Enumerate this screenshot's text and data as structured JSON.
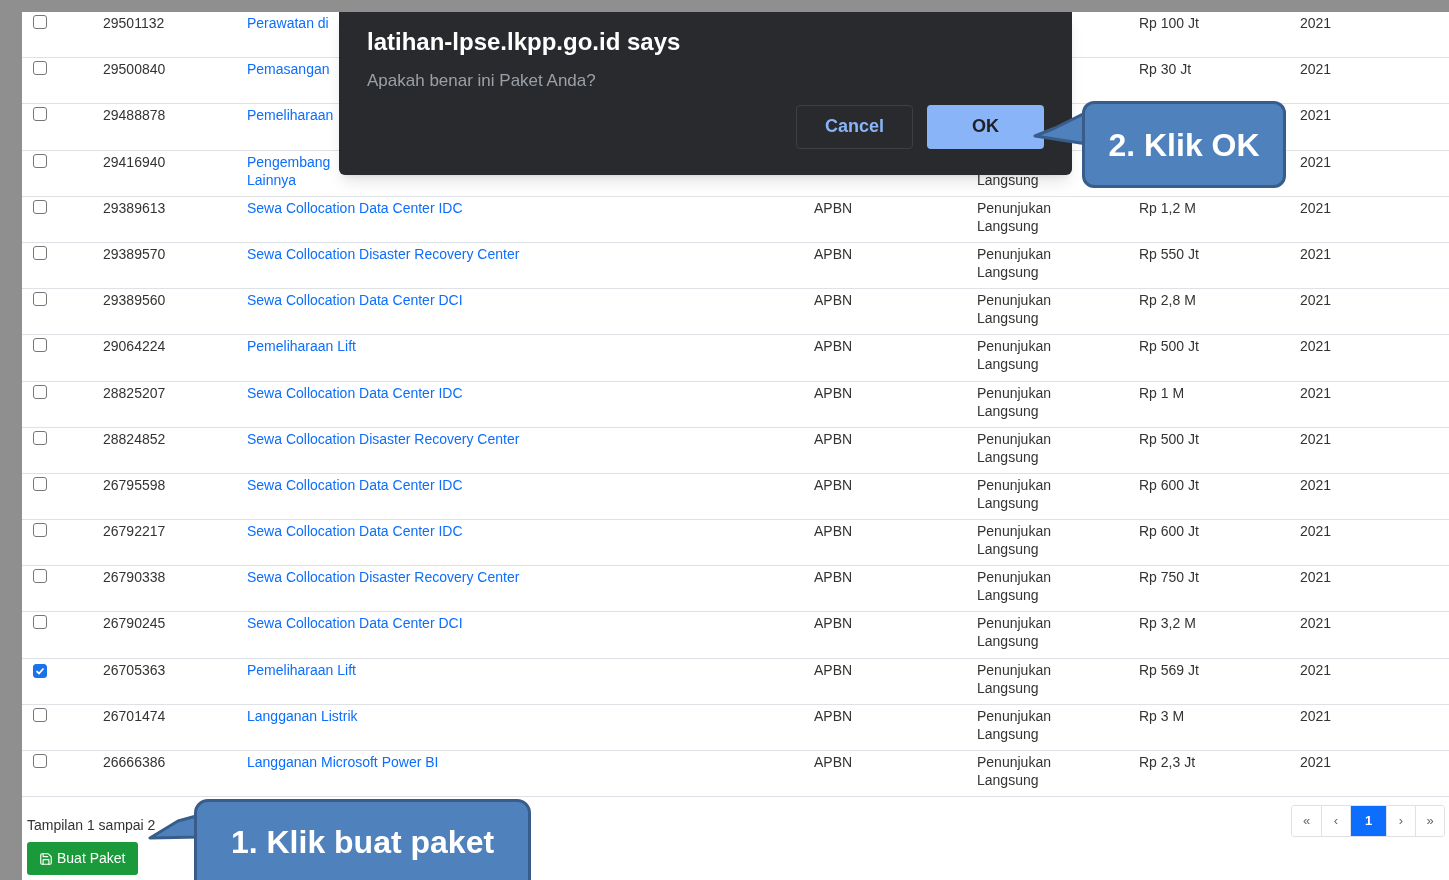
{
  "dialog": {
    "title": "latihan-lpse.lkpp.go.id says",
    "message": "Apakah benar ini Paket Anda?",
    "buttons": [
      {
        "label": "Cancel",
        "kind": "secondary"
      },
      {
        "label": "OK",
        "kind": "primary"
      }
    ]
  },
  "table": {
    "rows": [
      {
        "checked": false,
        "id": "29501132",
        "name": "Perawatan di",
        "pagu": "Rp 100 Jt",
        "year": "2021"
      },
      {
        "checked": false,
        "id": "29500840",
        "name": "Pemasangan",
        "pagu": "Rp 30 Jt",
        "year": "2021"
      },
      {
        "checked": false,
        "id": "29488878",
        "name": "Pemeliharaan",
        "year": "2021"
      },
      {
        "checked": false,
        "id": "29416940",
        "name": "Pengembang\nLainnya",
        "method": "\nLangsung",
        "year": "2021"
      },
      {
        "checked": false,
        "id": "29389613",
        "name": "Sewa Collocation Data Center IDC",
        "source": "APBN",
        "method": "Penunjukan\nLangsung",
        "pagu": "Rp 1,2 M",
        "year": "2021"
      },
      {
        "checked": false,
        "id": "29389570",
        "name": "Sewa Collocation Disaster Recovery Center",
        "source": "APBN",
        "method": "Penunjukan\nLangsung",
        "pagu": "Rp 550 Jt",
        "year": "2021"
      },
      {
        "checked": false,
        "id": "29389560",
        "name": "Sewa Collocation Data Center DCI",
        "source": "APBN",
        "method": "Penunjukan\nLangsung",
        "pagu": "Rp 2,8 M",
        "year": "2021"
      },
      {
        "checked": false,
        "id": "29064224",
        "name": "Pemeliharaan Lift",
        "source": "APBN",
        "method": "Penunjukan\nLangsung",
        "pagu": "Rp 500 Jt",
        "year": "2021"
      },
      {
        "checked": false,
        "id": "28825207",
        "name": "Sewa Collocation Data Center IDC",
        "source": "APBN",
        "method": "Penunjukan\nLangsung",
        "pagu": "Rp 1 M",
        "year": "2021"
      },
      {
        "checked": false,
        "id": "28824852",
        "name": "Sewa Collocation Disaster Recovery Center",
        "source": "APBN",
        "method": "Penunjukan\nLangsung",
        "pagu": "Rp 500 Jt",
        "year": "2021"
      },
      {
        "checked": false,
        "id": "26795598",
        "name": "Sewa Collocation Data Center IDC",
        "source": "APBN",
        "method": "Penunjukan\nLangsung",
        "pagu": "Rp 600 Jt",
        "year": "2021"
      },
      {
        "checked": false,
        "id": "26792217",
        "name": "Sewa Collocation Data Center IDC",
        "source": "APBN",
        "method": "Penunjukan\nLangsung",
        "pagu": "Rp 600 Jt",
        "year": "2021"
      },
      {
        "checked": false,
        "id": "26790338",
        "name": "Sewa Collocation Disaster Recovery Center",
        "source": "APBN",
        "method": "Penunjukan\nLangsung",
        "pagu": "Rp 750 Jt",
        "year": "2021"
      },
      {
        "checked": false,
        "id": "26790245",
        "name": "Sewa Collocation Data Center DCI",
        "source": "APBN",
        "method": "Penunjukan\nLangsung",
        "pagu": "Rp 3,2 M",
        "year": "2021"
      },
      {
        "checked": true,
        "id": "26705363",
        "name": "Pemeliharaan Lift",
        "source": "APBN",
        "method": "Penunjukan\nLangsung",
        "pagu": "Rp 569 Jt",
        "year": "2021"
      },
      {
        "checked": false,
        "id": "26701474",
        "name": "Langganan Listrik",
        "source": "APBN",
        "method": "Penunjukan\nLangsung",
        "pagu": "Rp 3 M",
        "year": "2021"
      },
      {
        "checked": false,
        "id": "26666386",
        "name": "Langganan Microsoft Power BI",
        "source": "APBN",
        "method": "Penunjukan\nLangsung",
        "pagu": "Rp 2,3 Jt",
        "year": "2021"
      }
    ]
  },
  "footer": {
    "info": "Tampilan 1 sampai 2",
    "create_button": "Buat Paket"
  },
  "pagination": [
    {
      "label": "«",
      "selected": false
    },
    {
      "label": "‹",
      "selected": false
    },
    {
      "label": "1",
      "selected": true
    },
    {
      "label": "›",
      "selected": false
    },
    {
      "label": "»",
      "selected": false
    }
  ],
  "callouts": [
    {
      "text": "2. Klik OK"
    },
    {
      "text": "1. Klik buat paket"
    }
  ]
}
